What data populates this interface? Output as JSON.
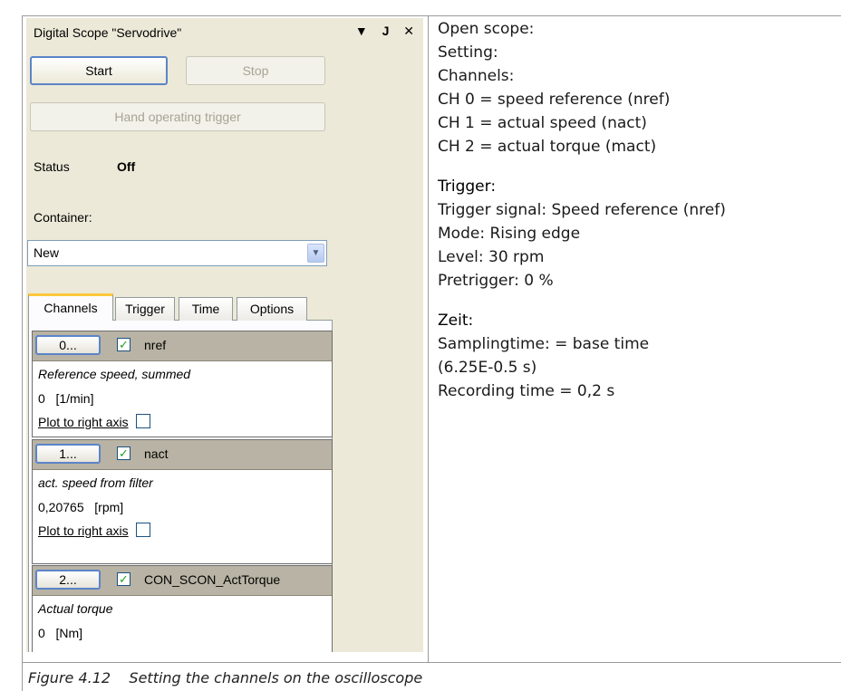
{
  "panel": {
    "title": "Digital Scope \"Servodrive\"",
    "title_buttons": {
      "dropdown": "▾",
      "pin": "ꟷ",
      "close": "✕"
    },
    "start_label": "Start",
    "stop_label": "Stop",
    "hand_trigger_label": "Hand operating trigger",
    "status_label": "Status",
    "status_value": "Off",
    "container_label": "Container:",
    "container_value": "New",
    "tabs": [
      {
        "label": "Channels",
        "active": true
      },
      {
        "label": "Trigger",
        "active": false
      },
      {
        "label": "Time",
        "active": false
      },
      {
        "label": "Options",
        "active": false
      }
    ],
    "channels": [
      {
        "button": "0...",
        "checked": true,
        "name": "nref",
        "description": "Reference speed, summed",
        "value": "0   [1/min]",
        "plot_label": "Plot to right axis"
      },
      {
        "button": "1...",
        "checked": true,
        "name": "nact",
        "description": "act. speed from filter",
        "value": "0,20765   [rpm]",
        "plot_label": "Plot to right axis"
      },
      {
        "button": "2...",
        "checked": true,
        "name": "CON_SCON_ActTorque",
        "description": "Actual torque",
        "value": "0   [Nm]",
        "plot_label": ""
      }
    ]
  },
  "notes": {
    "intro": [
      "Open scope:",
      "Setting:",
      "Channels:",
      "CH 0 = speed reference (nref)",
      "CH 1 = actual speed (nact)",
      "CH 2 = actual torque (mact)"
    ],
    "trigger_heading": "Trigger:",
    "trigger_lines": [
      "Trigger signal: Speed reference (nref)",
      "Mode: Rising edge",
      "Level: 30 rpm",
      "Pretrigger: 0 %"
    ],
    "time_heading": "Zeit:",
    "time_lines": [
      "Samplingtime: = base time",
      "(6.25E-0.5 s)",
      "Recording time = 0,2 s"
    ]
  },
  "caption": "Figure 4.12    Setting the channels on the oscilloscope",
  "colors": {
    "panel_bg": "#ece9d8",
    "tab_highlight": "#ffc83c",
    "button_focus": "#5c84c8",
    "channel_header": "#b8b3a4"
  }
}
